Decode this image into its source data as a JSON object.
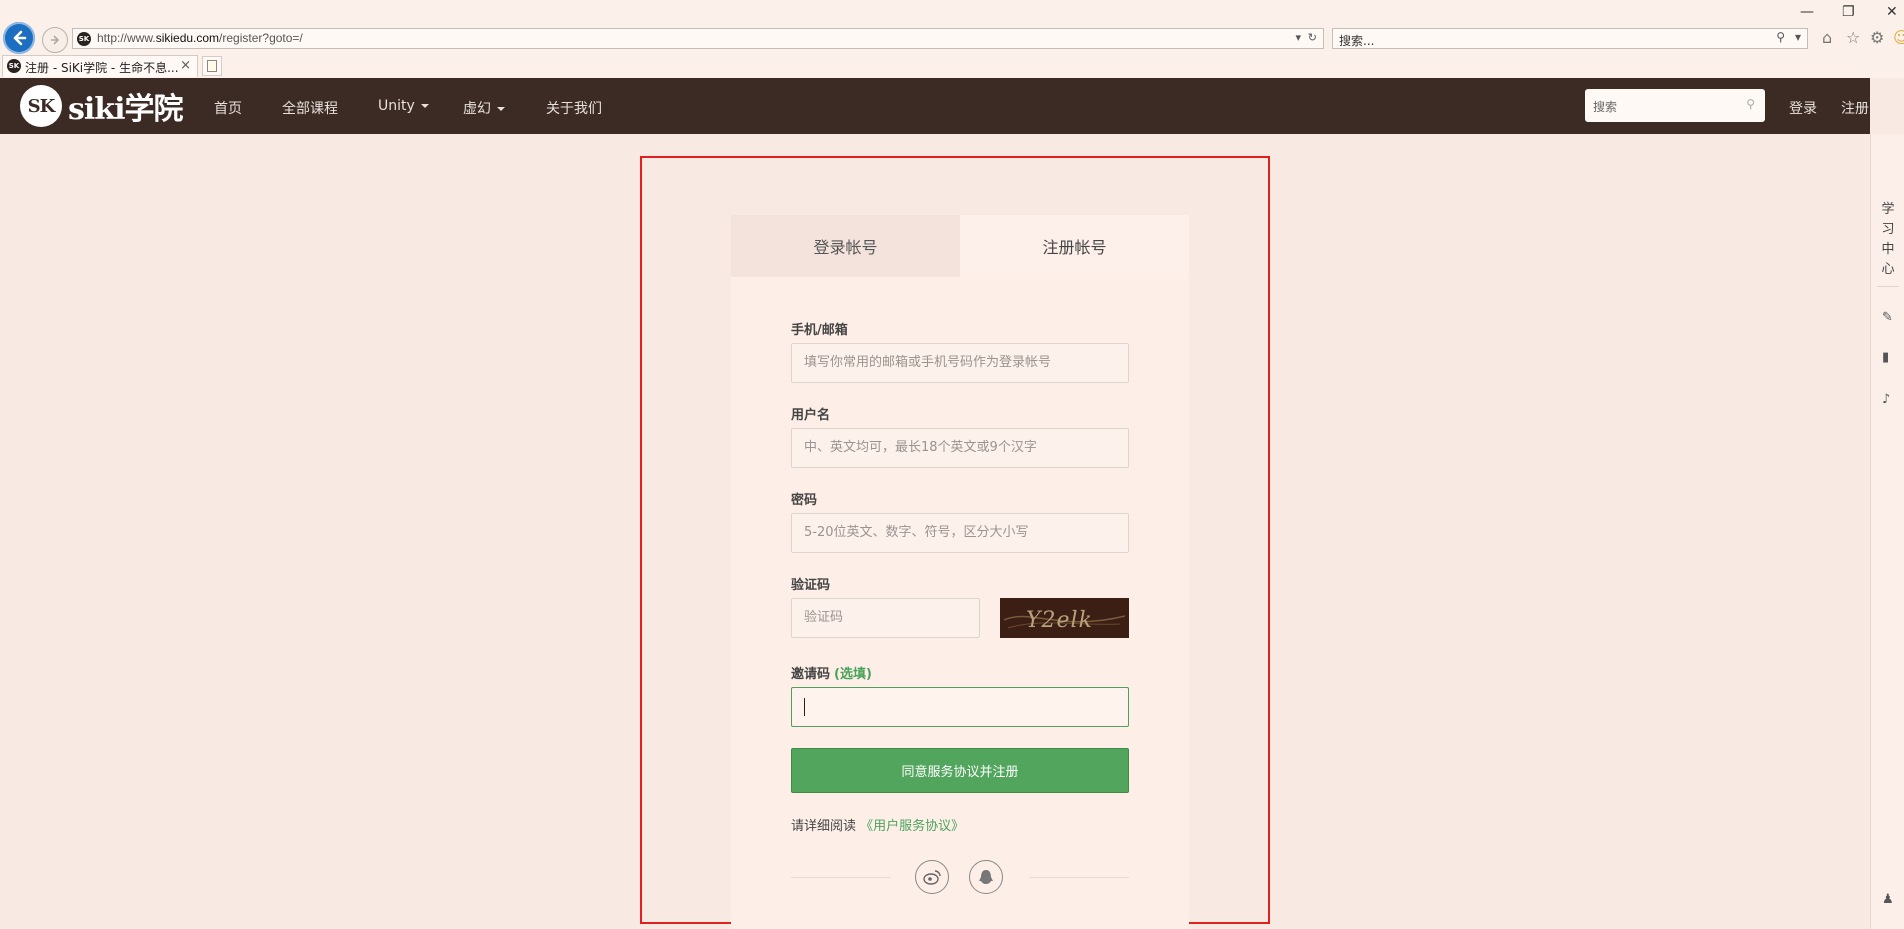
{
  "browser": {
    "url_prefix": "http://www.",
    "url_host": "sikiedu.com",
    "url_path": "/register?goto=/",
    "search_placeholder": "搜索...",
    "tab_title": "注册 - SiKi学院 - 生命不息...",
    "favicon_text": "SK"
  },
  "site": {
    "logo_badge": "SK",
    "logo_name": "siki学院",
    "nav": {
      "home": "首页",
      "all_courses": "全部课程",
      "unity": "Unity",
      "unreal": "虚幻",
      "about": "关于我们"
    },
    "search_placeholder": "搜索",
    "login": "登录",
    "register": "注册"
  },
  "rail": {
    "learning_center": "学习中心"
  },
  "form": {
    "tab_login": "登录帐号",
    "tab_register": "注册帐号",
    "account_label": "手机/邮箱",
    "account_placeholder": "填写你常用的邮箱或手机号码作为登录帐号",
    "username_label": "用户名",
    "username_placeholder": "中、英文均可，最长18个英文或9个汉字",
    "password_label": "密码",
    "password_placeholder": "5-20位英文、数字、符号，区分大小写",
    "captcha_label": "验证码",
    "captcha_placeholder": "验证码",
    "captcha_text": "Y2elk",
    "invite_label": "邀请码",
    "invite_optional": "(选填)",
    "invite_value": "",
    "submit": "同意服务协议并注册",
    "agree_prefix": "请详细阅读",
    "agree_link": "《用户服务协议》"
  },
  "colors": {
    "navbar": "#3c2b24",
    "accent_green": "#52a55c",
    "highlight_red": "#e32020",
    "page_bg": "#f9e9e3"
  }
}
